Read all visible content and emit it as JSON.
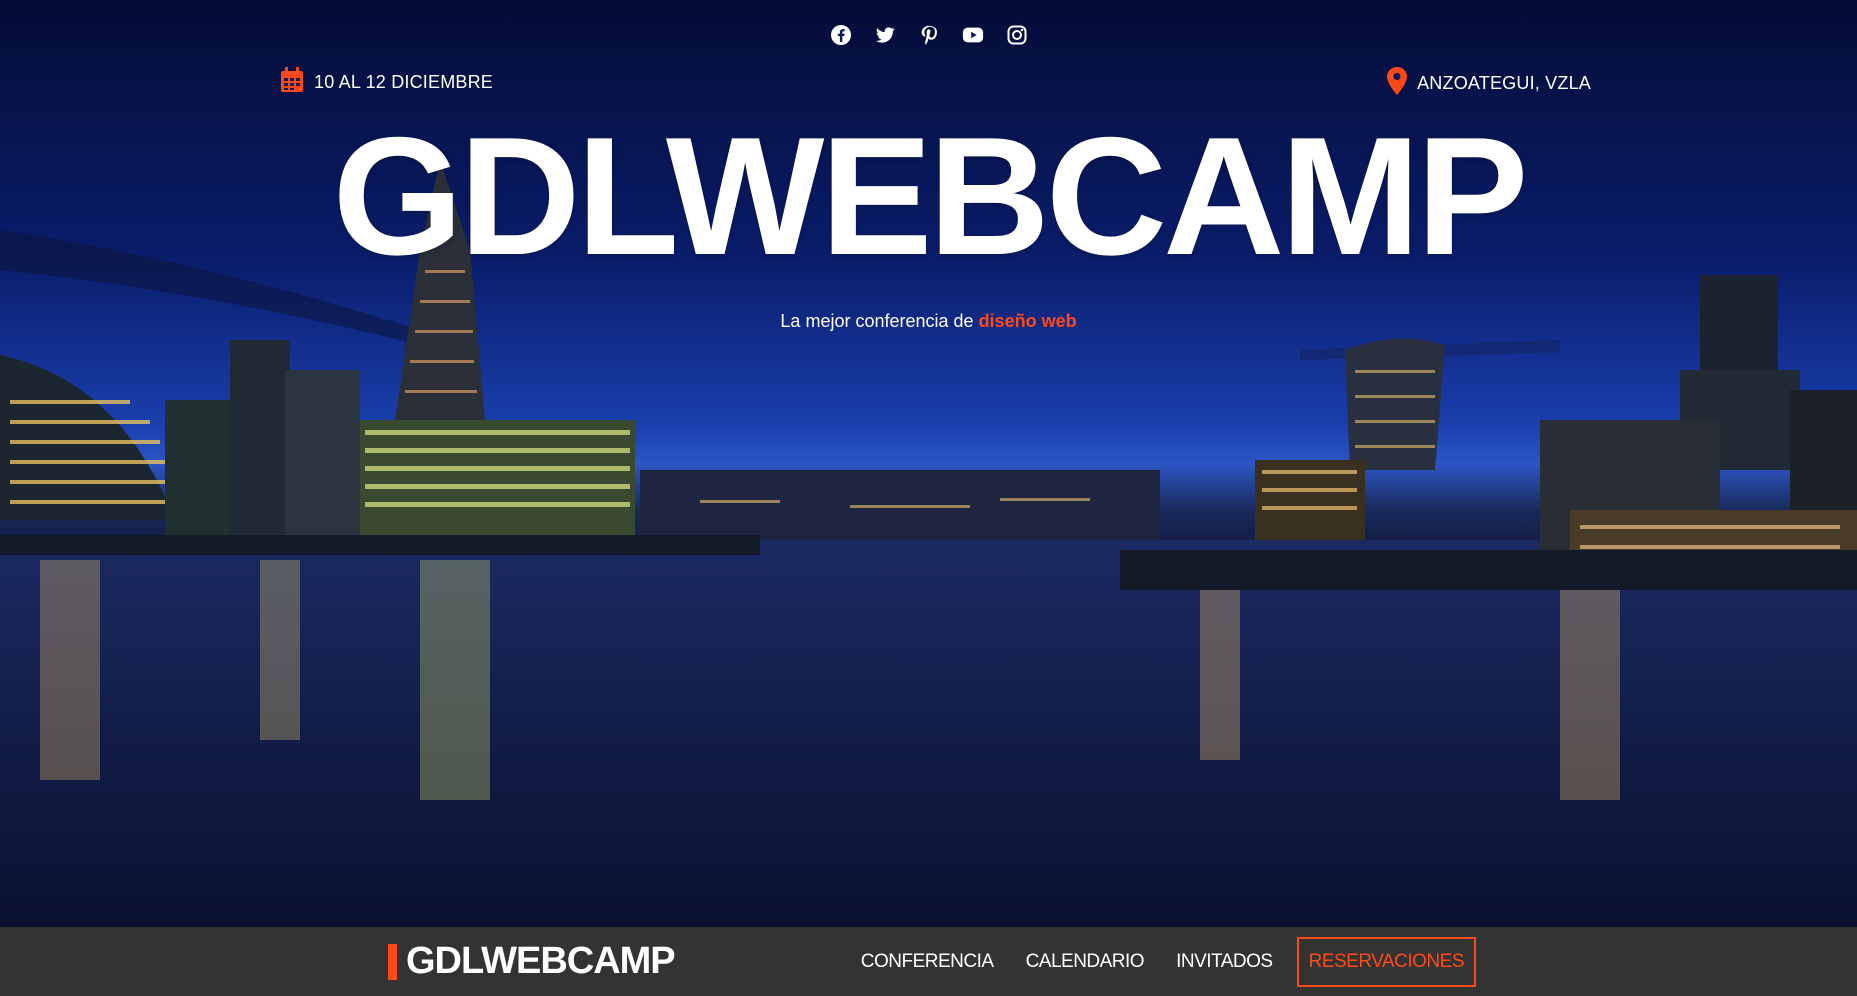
{
  "social": {
    "icons": [
      "facebook-icon",
      "twitter-icon",
      "pinterest-icon",
      "youtube-icon",
      "instagram-icon"
    ]
  },
  "event": {
    "date": "10 AL 12 DICIEMBRE",
    "location": "ANZOATEGUI, VZLA"
  },
  "hero": {
    "title": "GDLWEBCAMP",
    "slogan_prefix": "La mejor conferencia de",
    "slogan_accent": "diseño web"
  },
  "navbar": {
    "brand": "GDLWEBCAMP",
    "links": [
      "CONFERENCIA",
      "CALENDARIO",
      "INVITADOS"
    ],
    "cta": "RESERVACIONES"
  },
  "colors": {
    "accent": "#fe4918",
    "navbar_bg": "#333333",
    "text": "#ffffff"
  }
}
